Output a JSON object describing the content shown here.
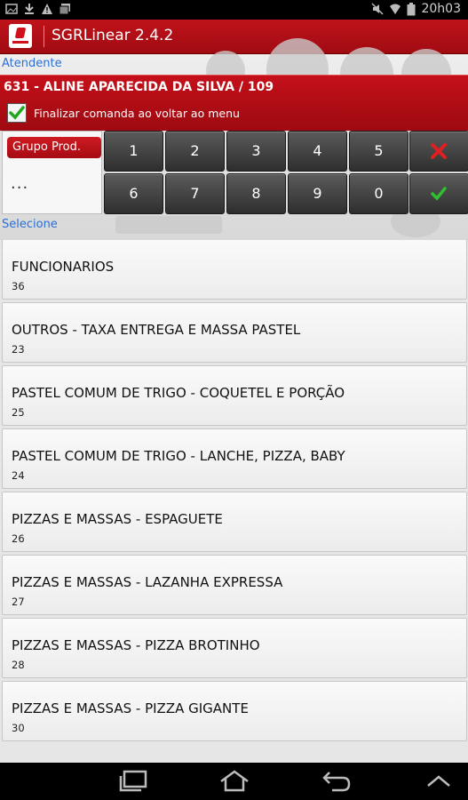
{
  "status_bar": {
    "time": "20h03",
    "left_icons": [
      "image-icon",
      "download-icon",
      "warning-icon",
      "gallery-icon"
    ],
    "right_icons": [
      "mute-icon",
      "wifi-icon",
      "battery-icon"
    ]
  },
  "action_bar": {
    "title": "SGRLinear 2.4.2"
  },
  "attendant": {
    "section_label": "Atendente",
    "name": "631 - ALINE APARECIDA DA SILVA / 109",
    "finalize_checkbox_label": "Finalizar comanda ao voltar ao menu",
    "finalize_checked": true
  },
  "group": {
    "button_label": "Grupo Prod.",
    "value": "..."
  },
  "keypad": {
    "row1": [
      "1",
      "2",
      "3",
      "4",
      "5"
    ],
    "row2": [
      "6",
      "7",
      "8",
      "9",
      "0"
    ]
  },
  "list": {
    "section_label": "Selecione",
    "items": [
      {
        "name": "FUNCIONARIOS",
        "code": "36"
      },
      {
        "name": "OUTROS - TAXA ENTREGA E MASSA PASTEL",
        "code": "23"
      },
      {
        "name": "PASTEL COMUM DE TRIGO - COQUETEL E PORÇÃO",
        "code": "25"
      },
      {
        "name": "PASTEL COMUM DE TRIGO - LANCHE, PIZZA, BABY",
        "code": "24"
      },
      {
        "name": "PIZZAS E MASSAS - ESPAGUETE",
        "code": "26"
      },
      {
        "name": "PIZZAS E MASSAS - LAZANHA EXPRESSA",
        "code": "27"
      },
      {
        "name": "PIZZAS E MASSAS - PIZZA BROTINHO",
        "code": "28"
      },
      {
        "name": "PIZZAS E MASSAS - PIZZA GIGANTE",
        "code": "30"
      }
    ]
  },
  "colors": {
    "brand_red": "#c0121a",
    "label_blue": "#2a6fd8",
    "clear_red": "#e02020",
    "confirm_green": "#2ec02e"
  }
}
